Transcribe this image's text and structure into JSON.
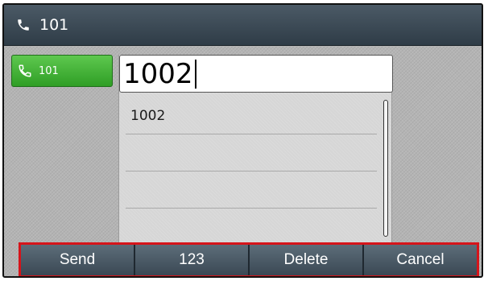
{
  "title_bar": {
    "icon": "phone-handset-icon",
    "title": "101"
  },
  "account": {
    "icon": "phone-handset-icon",
    "label": "101",
    "color": "#3cae2e"
  },
  "dial_input": {
    "value": "1002"
  },
  "suggestions": [
    {
      "text": "1002"
    },
    {
      "text": ""
    },
    {
      "text": ""
    },
    {
      "text": ""
    }
  ],
  "softkeys": [
    {
      "label": "Send"
    },
    {
      "label": "123"
    },
    {
      "label": "Delete"
    },
    {
      "label": "Cancel"
    }
  ],
  "highlight_color": "#d6141a"
}
